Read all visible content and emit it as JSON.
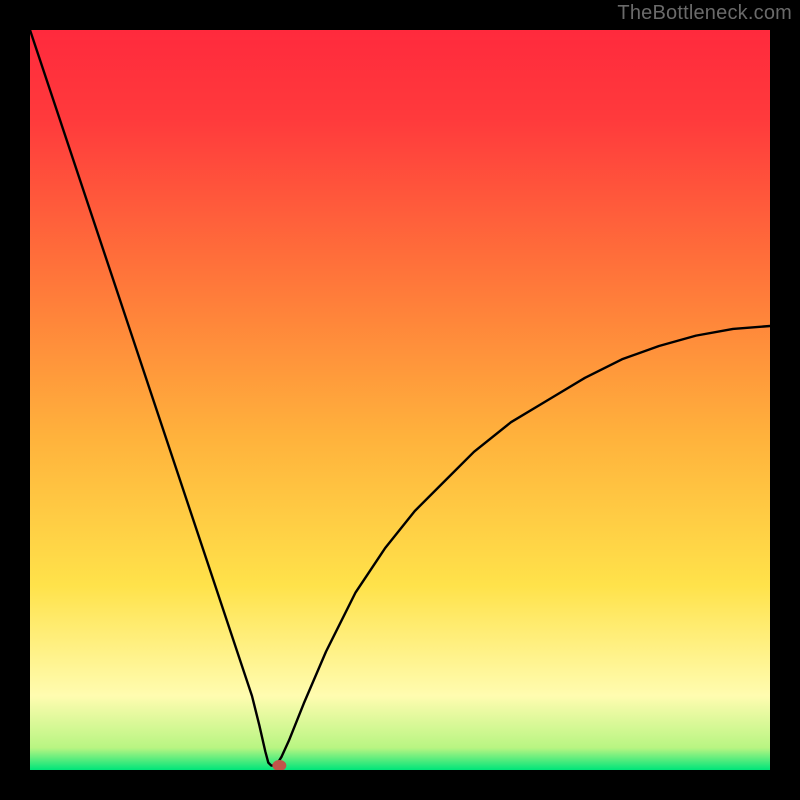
{
  "watermark": "TheBottleneck.com",
  "colors": {
    "background_black": "#000000",
    "gradient_red_top": "#ff2a3d",
    "gradient_orange": "#ffa03c",
    "gradient_yellow": "#ffe24a",
    "gradient_pale_yellow": "#fffcb0",
    "gradient_green_bottom": "#00e57a",
    "curve_stroke": "#000000",
    "marker_fill": "#c0554a"
  },
  "chart_data": {
    "type": "line",
    "title": "",
    "xlabel": "",
    "ylabel": "",
    "xlim": [
      0,
      100
    ],
    "ylim": [
      0,
      100
    ],
    "grid": false,
    "legend": false,
    "notes": "Bottleneck-style curve. y=100 at top (red), y=0 at bottom (green). Deep V-notch minimum near x≈32.5; right branch rises with diminishing slope toward ~60 at x=100.",
    "series": [
      {
        "name": "curve",
        "x": [
          0,
          4,
          8,
          12,
          16,
          20,
          24,
          28,
          30,
          31,
          31.8,
          32.2,
          32.6,
          33.0,
          33.5,
          34.0,
          35,
          37,
          40,
          44,
          48,
          52,
          56,
          60,
          65,
          70,
          75,
          80,
          85,
          90,
          95,
          100
        ],
        "values": [
          100,
          88,
          76,
          64,
          52,
          40,
          28,
          16,
          10,
          6,
          2.5,
          1.0,
          0.6,
          0.6,
          1.0,
          1.8,
          4,
          9,
          16,
          24,
          30,
          35,
          39,
          43,
          47,
          50,
          53,
          55.5,
          57.3,
          58.7,
          59.6,
          60
        ]
      }
    ],
    "marker": {
      "x": 33.7,
      "y": 0.6
    }
  }
}
